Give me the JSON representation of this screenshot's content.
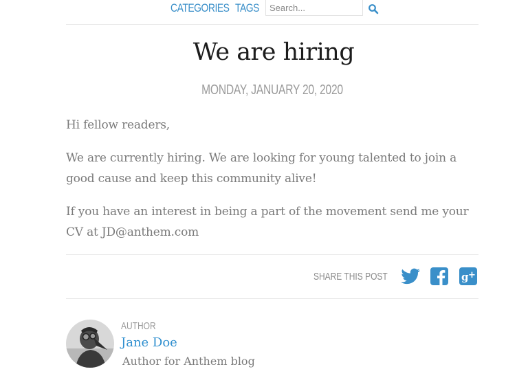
{
  "nav": {
    "categories": "CATEGORIES",
    "tags": "TAGS",
    "search_placeholder": "Search...",
    "search_icon": "search-icon"
  },
  "post": {
    "title": "We are hiring",
    "date": "MONDAY, JANUARY 20, 2020",
    "paragraphs": [
      "Hi fellow readers,",
      "We are currently hiring. We are looking for young talented to join a good cause and keep this community alive!",
      "If you have an interest in being a part of the movement send me your CV at JD@anthem.com"
    ]
  },
  "share": {
    "label": "SHARE THIS POST",
    "icons": [
      "twitter-icon",
      "facebook-icon",
      "google-plus-icon"
    ]
  },
  "author": {
    "label": "AUTHOR",
    "name": "Jane Doe",
    "bio": "Author for Anthem blog"
  },
  "colors": {
    "accent": "#3a8fc9",
    "title": "#1c1c1c",
    "text": "#7a7a7a"
  }
}
